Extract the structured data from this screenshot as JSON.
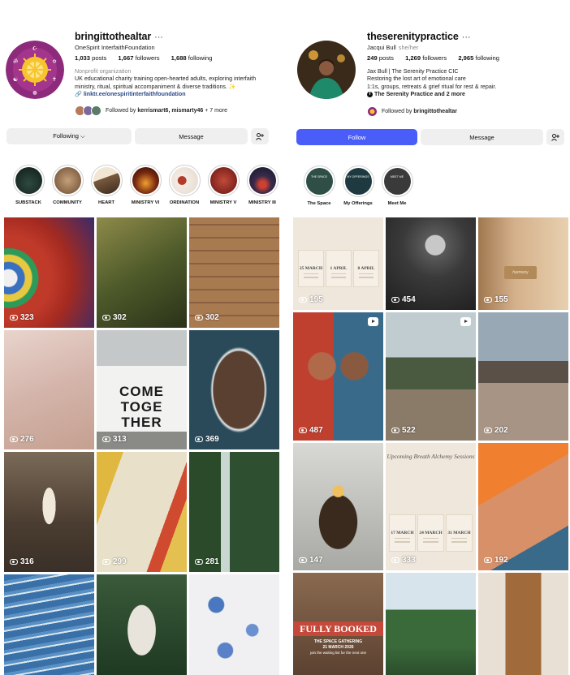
{
  "left": {
    "username": "bringittothealtar",
    "display_name": "OneSpirit InterfaithFoundation",
    "stats": {
      "posts": "1,033",
      "posts_label": "posts",
      "followers": "1,667",
      "followers_label": "followers",
      "following": "1,688",
      "following_label": "following"
    },
    "category": "Nonprofit organization",
    "bio_line1": "UK educational charity training open-hearted adults, exploring interfaith",
    "bio_line2": "ministry, ritual, spiritual accompaniment & diverse traditions. ✨",
    "link": "linktr.ee/onespiritinterfaithfoundation",
    "followed_by_prefix": "Followed by",
    "followed_by_names": "kerrismart6, mismarty46",
    "followed_by_more": "+ 7 more",
    "buttons": {
      "following": "Following ⌵",
      "message": "Message"
    },
    "highlights": [
      "SUBSTACK",
      "COMMUNITY",
      "HEART",
      "MINISTRY VI",
      "ORDINATION",
      "MINISTRY V",
      "MINISTRY III"
    ],
    "tiles": [
      {
        "views": "323"
      },
      {
        "views": "302"
      },
      {
        "views": "302"
      },
      {
        "views": "276"
      },
      {
        "views": "313"
      },
      {
        "views": "369"
      },
      {
        "views": "316"
      },
      {
        "views": "299"
      },
      {
        "views": "281"
      },
      {
        "views": ""
      },
      {
        "views": ""
      },
      {
        "views": ""
      }
    ],
    "come_text": [
      "COME",
      "TOGE",
      "THER"
    ]
  },
  "right": {
    "username": "theserenitypractice",
    "display_name": "Jacqui Bull",
    "pronouns": "she/her",
    "stats": {
      "posts": "249",
      "posts_label": "posts",
      "followers": "1,269",
      "followers_label": "followers",
      "following": "2,965",
      "following_label": "following"
    },
    "bio_line1": "Jax Bull | The Serenity Practice CIC",
    "bio_line2": "Restoring the lost art of emotional care",
    "bio_line3": "1:1s, groups, retreats & grief ritual for rest & repair.",
    "fb_link": "The Serenity Practice and 2 more",
    "followed_by_prefix": "Followed by",
    "followed_by_names": "bringittothealtar",
    "buttons": {
      "follow": "Follow",
      "message": "Message"
    },
    "highlights": [
      "The Space",
      "My Offerings",
      "Meet Me"
    ],
    "highlight_inner": [
      "THE SPACE",
      "MY OFFERINGS",
      "MEET ME"
    ],
    "tiles": [
      {
        "views": "195"
      },
      {
        "views": "454"
      },
      {
        "views": "155"
      },
      {
        "views": "487"
      },
      {
        "views": "522"
      },
      {
        "views": "202"
      },
      {
        "views": "147"
      },
      {
        "views": "333"
      },
      {
        "views": "192"
      },
      {
        "views": ""
      },
      {
        "views": ""
      },
      {
        "views": ""
      }
    ],
    "march_dates": [
      "25 MARCH",
      "1 APRIL",
      "8 APRIL"
    ],
    "session_title": "Upcoming Breath Alchemy Sessions",
    "session_dates": [
      "17 MARCH",
      "24 MARCH",
      "31 MARCH"
    ],
    "sign_text": "harmony",
    "booked": "FULLY BOOKED",
    "booked_sub": "THE SPACE GATHERING",
    "booked_date": "21 MARCH 2026",
    "booked_note": "join the waiting list for the next one"
  },
  "colors": {
    "follow_blue": "#4a5df9",
    "link_blue": "#2d4a8a",
    "button_grey": "#efefef"
  },
  "icons": {
    "more": "ellipsis-icon",
    "add_person": "add-person-icon",
    "views": "eye-icon",
    "reel": "reel-icon",
    "facebook": "facebook-icon"
  }
}
